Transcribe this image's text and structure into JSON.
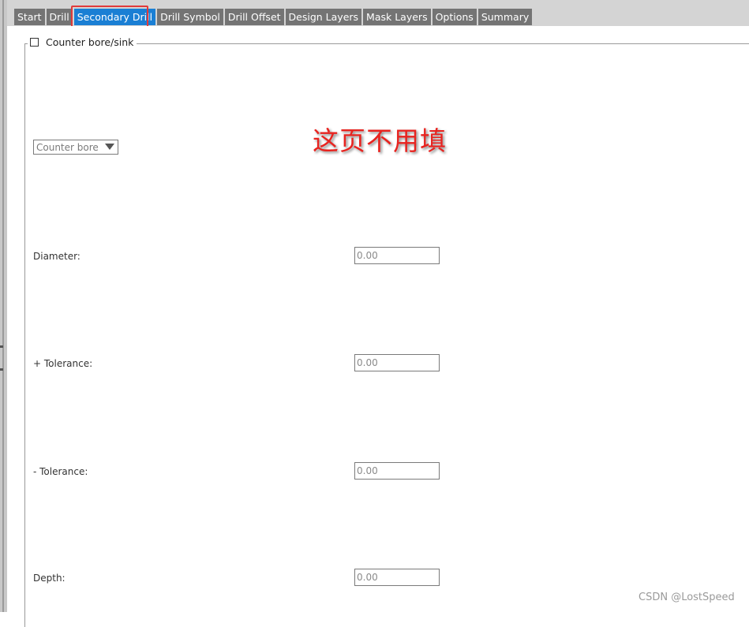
{
  "tabs": [
    {
      "label": "Start"
    },
    {
      "label": "Drill"
    },
    {
      "label": "Secondary Drill",
      "active": true
    },
    {
      "label": "Drill Symbol"
    },
    {
      "label": "Drill Offset"
    },
    {
      "label": "Design Layers"
    },
    {
      "label": "Mask Layers"
    },
    {
      "label": "Options"
    },
    {
      "label": "Summary"
    }
  ],
  "group": {
    "checkbox_label": "Counter bore/sink",
    "checked": false
  },
  "type_select": {
    "selected": "Counter bore"
  },
  "fields": {
    "diameter": {
      "label": "Diameter:",
      "value": "0.00"
    },
    "plus_tolerance": {
      "label": "+ Tolerance:",
      "value": "0.00"
    },
    "minus_tolerance": {
      "label": "- Tolerance:",
      "value": "0.00"
    },
    "depth": {
      "label": "Depth:",
      "value": "0.00"
    }
  },
  "annotation": {
    "text": "这页不用填",
    "color": "#e8231f"
  },
  "watermark": {
    "text": "CSDN @LostSpeed"
  },
  "colors": {
    "active_tab": "#1a7fd4",
    "inactive_tab": "#747474",
    "highlight": "#e03a3a"
  }
}
